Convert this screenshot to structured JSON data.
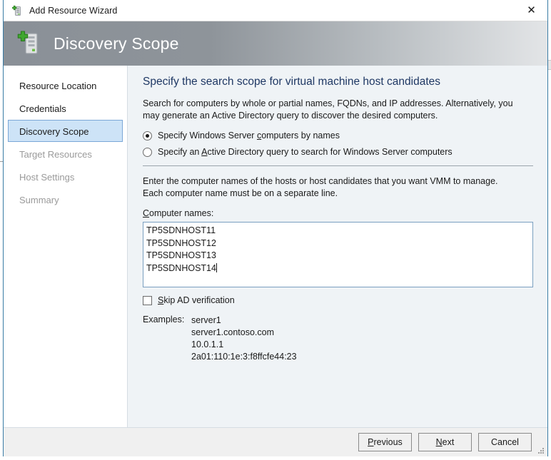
{
  "window": {
    "title": "Add Resource Wizard",
    "title_icon": "server-add-icon",
    "close_label": "✕"
  },
  "banner": {
    "title": "Discovery Scope",
    "icon": "server-add-large-icon"
  },
  "sidebar": {
    "items": [
      {
        "label": "Resource Location",
        "state": "visited"
      },
      {
        "label": "Credentials",
        "state": "visited"
      },
      {
        "label": "Discovery Scope",
        "state": "active"
      },
      {
        "label": "Target Resources",
        "state": "disabled"
      },
      {
        "label": "Host Settings",
        "state": "disabled"
      },
      {
        "label": "Summary",
        "state": "disabled"
      }
    ]
  },
  "content": {
    "heading": "Specify the search scope for virtual machine host candidates",
    "description": "Search for computers by whole or partial names, FQDNs, and IP addresses. Alternatively, you may generate an Active Directory query to discover the desired computers.",
    "radios": [
      {
        "label_before": "Specify Windows Server ",
        "accel": "c",
        "label_after": "omputers by names",
        "checked": true
      },
      {
        "label_before": "Specify an ",
        "accel": "A",
        "label_after": "ctive Directory query to search for Windows Server computers",
        "checked": false
      }
    ],
    "instruction": "Enter the computer names of the hosts or host candidates that you want VMM to manage. Each computer name must be on a separate line.",
    "field_label_accel": "C",
    "field_label_rest": "omputer names:",
    "computer_names": [
      "TP5SDNHOST11",
      "TP5SDNHOST12",
      "TP5SDNHOST13",
      "TP5SDNHOST14"
    ],
    "skip_ad": {
      "accel": "S",
      "label_rest": "kip AD verification",
      "checked": false
    },
    "examples_label": "Examples:",
    "examples": [
      "server1",
      "server1.contoso.com",
      "10.0.1.1",
      "2a01:110:1e:3:f8ffcfe44:23"
    ]
  },
  "footer": {
    "previous": {
      "accel": "P",
      "rest": "revious"
    },
    "next": {
      "accel": "N",
      "rest": "ext"
    },
    "cancel": {
      "label": "Cancel"
    }
  },
  "colors": {
    "accent": "#1f3864",
    "selection": "#cde3f7",
    "window_border": "#3a7ca5",
    "content_bg": "#eff3f6"
  }
}
